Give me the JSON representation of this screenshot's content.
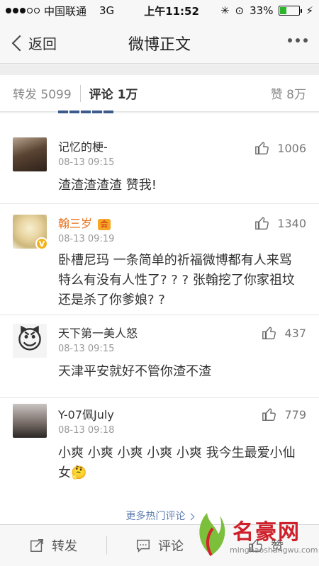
{
  "status_bar": {
    "carrier": "中国联通",
    "network": "3G",
    "time": "上午11:52",
    "battery": "33%",
    "battery_level": 0.33
  },
  "nav": {
    "back_label": "返回",
    "title": "微博正文"
  },
  "tabs": {
    "reposts": "转发 5099",
    "comments": "评论 1万",
    "likes": "赞 8万"
  },
  "comments": [
    {
      "user": "记忆的梗-",
      "time": "08-13 09:15",
      "likes": "1006",
      "text": "渣渣渣渣渣 赞我!"
    },
    {
      "user": "翰三岁",
      "vip_badge": "会",
      "verified": "V",
      "time": "08-13 09:19",
      "likes": "1340",
      "text": "卧槽尼玛 一条简单的祈福微博都有人来骂 特么有没有人性了? ? ? 张翰挖了你家祖坟还是杀了你爹娘? ?"
    },
    {
      "user": "天下第一美人怒",
      "time": "08-13 09:15",
      "likes": "437",
      "text": "天津平安就好不管你渣不渣",
      "avatar_emoji": "😈"
    },
    {
      "user": "Y-07佩July",
      "time": "08-13 09:18",
      "likes": "779",
      "text": "小爽 小爽 小爽 小爽 小爽 我今生最爱小仙女",
      "emoji": "🤔"
    }
  ],
  "more_hot": "更多热门评论",
  "bottom_bar": {
    "repost": "转发",
    "comment": "评论",
    "like": "赞"
  },
  "watermark": {
    "name": "名豪网",
    "url": "minghaoshangwu.com"
  },
  "colors": {
    "vip_name": "#e8711a",
    "link": "#5d7db0",
    "watermark": "#cf1f2a"
  }
}
